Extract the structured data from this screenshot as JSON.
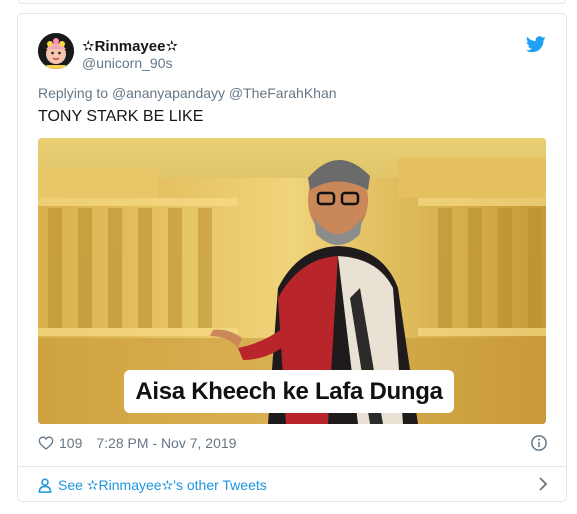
{
  "tweet": {
    "display_name": "✫Rinmayee✫",
    "handle": "@unicorn_90s",
    "reply_prefix": "Replying to",
    "reply_to": [
      "@ananyapandayy",
      "@TheFarahKhan"
    ],
    "text": "TONY STARK BE LIKE",
    "media_caption": "Aisa Kheech ke Lafa Dunga",
    "like_count": "109",
    "timestamp": "7:28 PM - Nov 7, 2019",
    "see_more": "See ✫Rinmayee✫'s other Tweets"
  },
  "icons": {
    "brand": "twitter-bird-icon",
    "like": "heart-icon",
    "info": "info-icon",
    "profile": "person-icon",
    "more": "chevron-right-icon"
  },
  "colors": {
    "link": "#1b95e0",
    "muted": "#657786",
    "text": "#14171a",
    "border": "#e1e8ed",
    "twitter_blue": "#1da1f2"
  }
}
